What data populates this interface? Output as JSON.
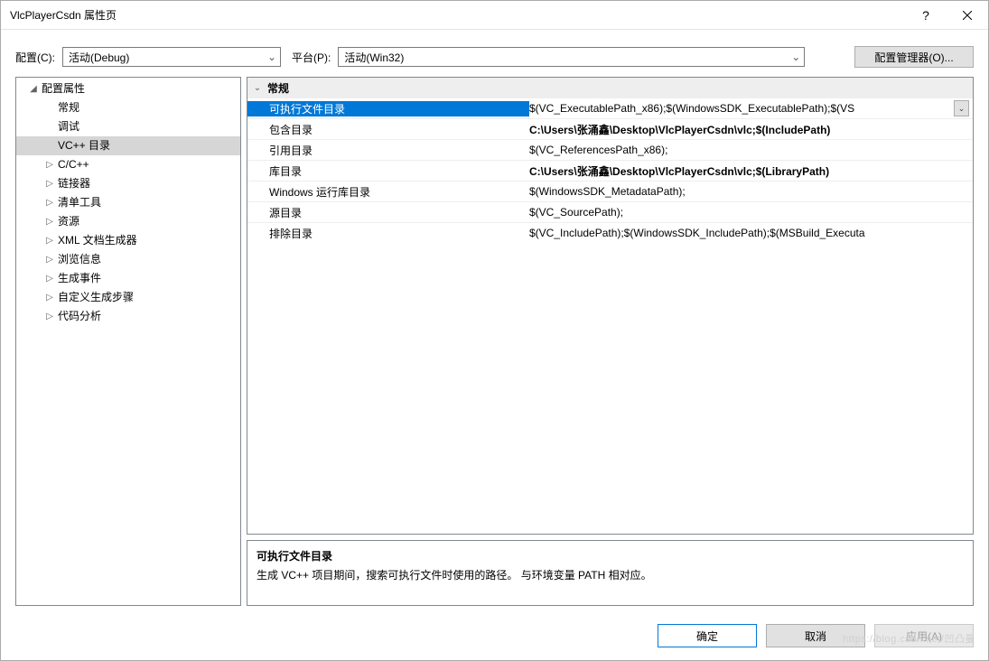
{
  "window": {
    "title": "VlcPlayerCsdn 属性页"
  },
  "toolbar": {
    "config_label": "配置(C):",
    "config_value": "活动(Debug)",
    "platform_label": "平台(P):",
    "platform_value": "活动(Win32)",
    "config_manager": "配置管理器(O)..."
  },
  "tree": {
    "root": "配置属性",
    "items": [
      "常规",
      "调试",
      "VC++ 目录",
      "C/C++",
      "链接器",
      "清单工具",
      "资源",
      "XML 文档生成器",
      "浏览信息",
      "生成事件",
      "自定义生成步骤",
      "代码分析"
    ]
  },
  "grid": {
    "section": "常规",
    "rows": [
      {
        "name": "可执行文件目录",
        "value": "$(VC_ExecutablePath_x86);$(WindowsSDK_ExecutablePath);$(VS",
        "selected": true
      },
      {
        "name": "包含目录",
        "value": "C:\\Users\\张涌鑫\\Desktop\\VlcPlayerCsdn\\vlc;$(IncludePath)",
        "bold": true
      },
      {
        "name": "引用目录",
        "value": "$(VC_ReferencesPath_x86);"
      },
      {
        "name": "库目录",
        "value": "C:\\Users\\张涌鑫\\Desktop\\VlcPlayerCsdn\\vlc;$(LibraryPath)",
        "bold": true
      },
      {
        "name": "Windows 运行库目录",
        "value": "$(WindowsSDK_MetadataPath);"
      },
      {
        "name": "源目录",
        "value": "$(VC_SourcePath);"
      },
      {
        "name": "排除目录",
        "value": "$(VC_IncludePath);$(WindowsSDK_IncludePath);$(MSBuild_Executa"
      }
    ]
  },
  "description": {
    "title": "可执行文件目录",
    "body": "生成 VC++ 项目期间，搜索可执行文件时使用的路径。 与环境变量 PATH 相对应。"
  },
  "footer": {
    "ok": "确定",
    "cancel": "取消",
    "apply": "应用(A)"
  },
  "watermark": "https://blog.csdn.net/凹凸曼"
}
